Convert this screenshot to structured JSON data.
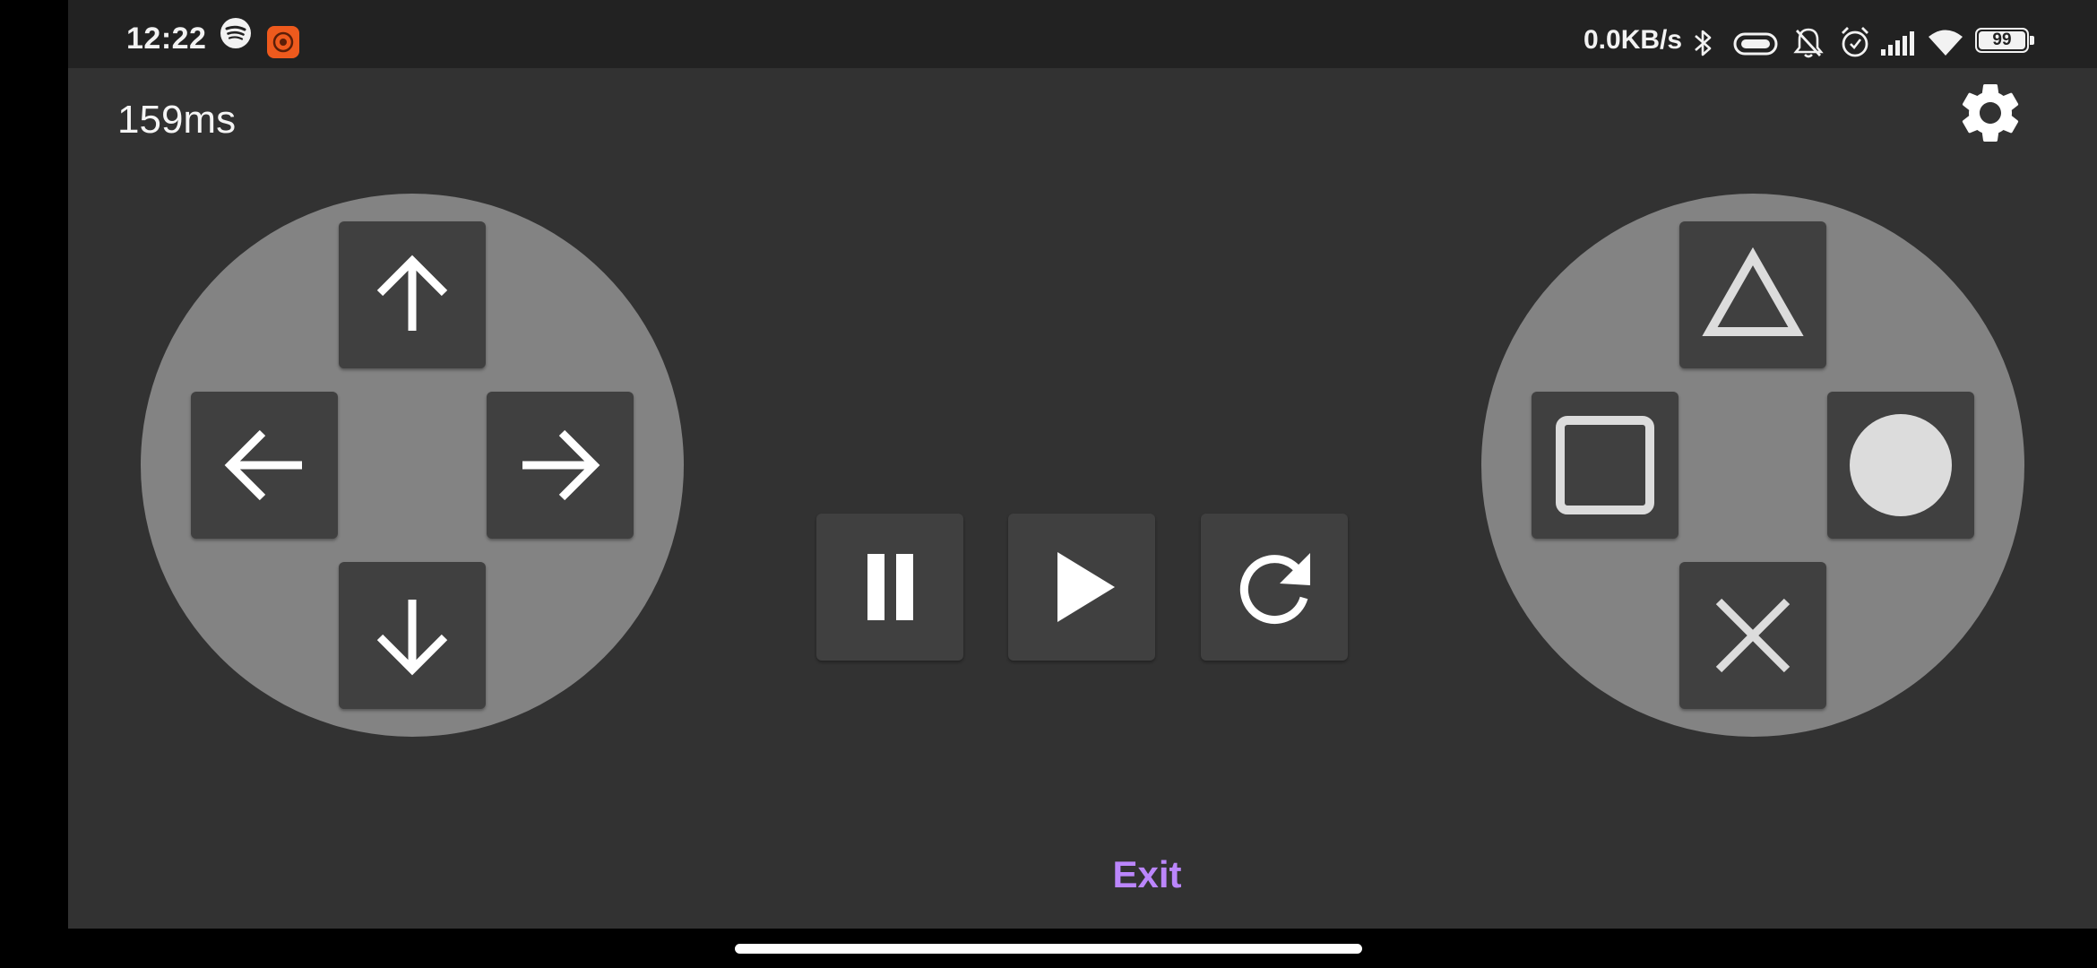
{
  "status_bar": {
    "time": "12:22",
    "net_speed": "0.0KB/s",
    "battery": "99",
    "icons": [
      "spotify-icon",
      "recorder-icon",
      "bluetooth-icon",
      "vibrate-icon",
      "mute-icon",
      "alarm-icon",
      "signal-icon",
      "wifi-icon",
      "battery-icon"
    ]
  },
  "app": {
    "latency": "159ms",
    "settings_icon": "gear-icon",
    "exit_label": "Exit",
    "dpad": {
      "keys": [
        "arrow-up-icon",
        "arrow-left-icon",
        "arrow-right-icon",
        "arrow-down-icon"
      ]
    },
    "action_pad": {
      "keys": [
        "triangle-icon",
        "square-icon",
        "circle-icon",
        "cross-icon"
      ]
    },
    "media_controls": [
      "pause-icon",
      "play-icon",
      "restart-icon"
    ]
  },
  "colors": {
    "background": "#323232",
    "status_bar": "#222222",
    "pad_circle": "#838383",
    "key": "#404040",
    "accent": "#bb86fc",
    "recorder": "#ee5a1d"
  }
}
